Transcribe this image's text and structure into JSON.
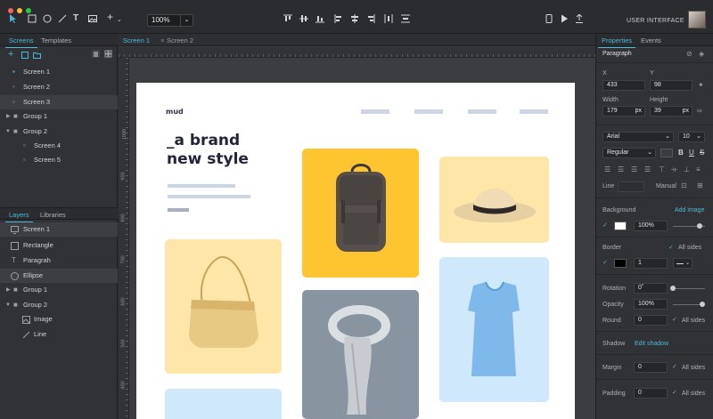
{
  "toolbar": {
    "zoom": "100%",
    "zoom_arrow": "⌄",
    "mode_label": "USER INTERFACE",
    "mode_arrow": "⌄"
  },
  "left_panel": {
    "tabs": {
      "screens": "Screens",
      "templates": "Templates"
    },
    "screens": [
      {
        "label": "Screen 1"
      },
      {
        "label": "Screen 2"
      },
      {
        "label": "Screen 3"
      },
      {
        "label": "Group 1"
      },
      {
        "label": "Group 2"
      },
      {
        "label": "Screen 4"
      },
      {
        "label": "Screen 5"
      }
    ],
    "layer_tabs": {
      "layers": "Layers",
      "libraries": "Libraries"
    },
    "layers": [
      {
        "label": "Screen 1"
      },
      {
        "label": "Rectangle"
      },
      {
        "label": "Paragrah"
      },
      {
        "label": "Ellipse"
      },
      {
        "label": "Group 1"
      },
      {
        "label": "Group 2"
      },
      {
        "label": "Image"
      },
      {
        "label": "Line"
      }
    ]
  },
  "canvas": {
    "tabs": [
      {
        "label": "Screen 1",
        "close": "×"
      },
      {
        "label": "Screen 2"
      }
    ],
    "ruler_v": [
      "1000",
      "900",
      "800",
      "700",
      "600",
      "500",
      "400",
      "300"
    ],
    "artboard": {
      "logo": "mud",
      "headline_1": "_a brand",
      "headline_2": "new style"
    }
  },
  "properties": {
    "tabs": {
      "properties": "Properties",
      "events": "Events"
    },
    "element": "Paragraph",
    "x_label": "X",
    "y_label": "Y",
    "x": "433",
    "y": "98",
    "width_label": "Width",
    "height_label": "Height",
    "width": "179",
    "height": "39",
    "unit": "px",
    "font_family": "Arial",
    "font_size": "10",
    "font_weight": "Regular",
    "line_label": "Line",
    "line_mode": "Manual",
    "background_label": "Background",
    "add_image": "Add image",
    "background_opacity": "100%",
    "border_label": "Border",
    "all_sides": "All sides",
    "border_width": "1",
    "rotation_label": "Rotation",
    "rotation": "0˚",
    "opacity_label": "Opacity",
    "opacity": "100%",
    "round_label": "Round",
    "round": "0",
    "shadow_label": "Shadow",
    "edit_shadow": "Edit shadow",
    "margin_label": "Margin",
    "margin": "0",
    "padding_label": "Padding",
    "padding": "0"
  },
  "colors": {
    "accent": "#4fb8d6",
    "card_yellow": "#ffc531",
    "card_pale_yellow": "#fde6a7",
    "card_gray": "#8895a1",
    "card_light_blue": "#cfe8fb",
    "headline": "#22243a"
  }
}
